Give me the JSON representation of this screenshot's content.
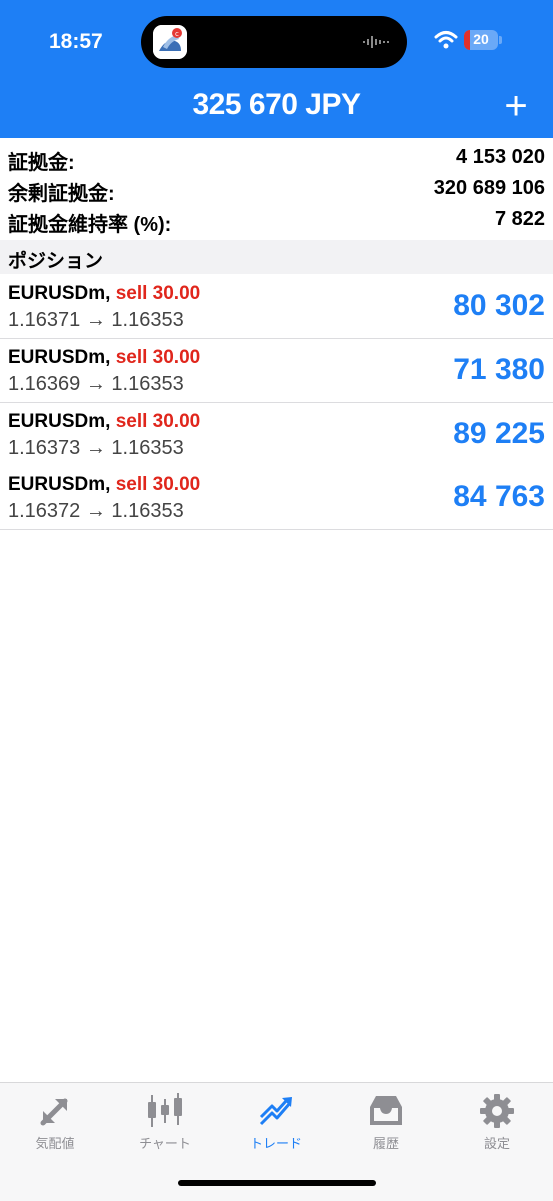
{
  "status": {
    "time": "18:57",
    "battery": "20"
  },
  "header": {
    "balance": "325 670 JPY",
    "add_label": "+"
  },
  "margin": [
    {
      "label": "証拠金:",
      "value": "4 153 020"
    },
    {
      "label": "余剰証拠金:",
      "value": "320 689 106"
    },
    {
      "label": "証拠金維持率 (%):",
      "value": "7 822"
    }
  ],
  "positions_title": "ポジション",
  "positions": [
    {
      "symbol": "EURUSDm,",
      "side": "sell 30.00",
      "prices": "1.16371 → 1.16353",
      "profit": "80 302"
    },
    {
      "symbol": "EURUSDm,",
      "side": "sell 30.00",
      "prices": "1.16369 → 1.16353",
      "profit": "71 380"
    },
    {
      "symbol": "EURUSDm,",
      "side": "sell 30.00",
      "prices": "1.16373 → 1.16353",
      "profit": "89 225"
    },
    {
      "symbol": "EURUSDm,",
      "side": "sell 30.00",
      "prices": "1.16372 → 1.16353",
      "profit": "84 763"
    }
  ],
  "tabs": [
    {
      "label": "気配値",
      "icon": "quotes-icon"
    },
    {
      "label": "チャート",
      "icon": "chart-icon"
    },
    {
      "label": "トレード",
      "icon": "trade-icon"
    },
    {
      "label": "履歴",
      "icon": "history-icon"
    },
    {
      "label": "設定",
      "icon": "settings-icon"
    }
  ],
  "colors": {
    "accent": "#1e7ff5",
    "sell": "#e0261c",
    "battery_low": "#e2302b"
  }
}
